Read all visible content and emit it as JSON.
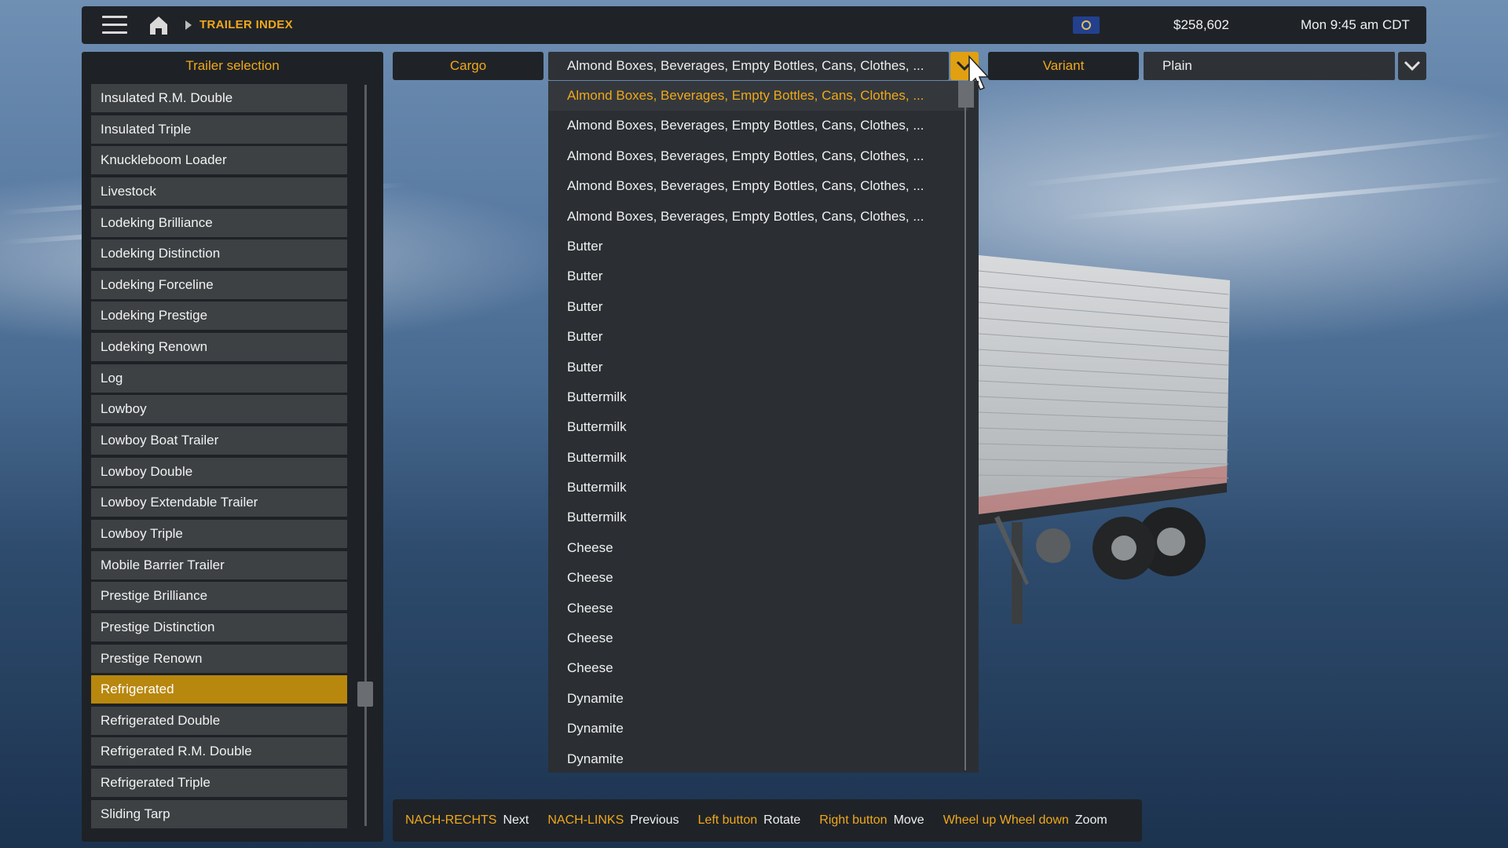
{
  "topbar": {
    "breadcrumb": "TRAILER INDEX",
    "money": "$258,602",
    "time": "Mon 9:45 am CDT"
  },
  "left_panel": {
    "title": "Trailer selection",
    "items": [
      "Insulated R.M. Double",
      "Insulated Triple",
      "Knuckleboom Loader",
      "Livestock",
      "Lodeking Brilliance",
      "Lodeking Distinction",
      "Lodeking Forceline",
      "Lodeking Prestige",
      "Lodeking Renown",
      "Log",
      "Lowboy",
      "Lowboy Boat Trailer",
      "Lowboy Double",
      "Lowboy Extendable Trailer",
      "Lowboy Triple",
      "Mobile Barrier Trailer",
      "Prestige Brilliance",
      "Prestige Distinction",
      "Prestige Renown",
      "Refrigerated",
      "Refrigerated Double",
      "Refrigerated R.M. Double",
      "Refrigerated Triple",
      "Sliding Tarp"
    ],
    "selected": "Refrigerated"
  },
  "cargo": {
    "label": "Cargo",
    "selected": "Almond Boxes, Beverages, Empty Bottles, Cans, Clothes, ...",
    "options": [
      "Almond Boxes, Beverages, Empty Bottles, Cans, Clothes, ...",
      "Almond Boxes, Beverages, Empty Bottles, Cans, Clothes, ...",
      "Almond Boxes, Beverages, Empty Bottles, Cans, Clothes, ...",
      "Almond Boxes, Beverages, Empty Bottles, Cans, Clothes, ...",
      "Almond Boxes, Beverages, Empty Bottles, Cans, Clothes, ...",
      "Butter",
      "Butter",
      "Butter",
      "Butter",
      "Butter",
      "Buttermilk",
      "Buttermilk",
      "Buttermilk",
      "Buttermilk",
      "Buttermilk",
      "Cheese",
      "Cheese",
      "Cheese",
      "Cheese",
      "Cheese",
      "Dynamite",
      "Dynamite",
      "Dynamite"
    ]
  },
  "variant": {
    "label": "Variant",
    "selected": "Plain"
  },
  "hints": [
    {
      "key": "NACH-RECHTS",
      "action": "Next"
    },
    {
      "key": "NACH-LINKS",
      "action": "Previous"
    },
    {
      "key": "Left button",
      "action": "Rotate"
    },
    {
      "key": "Right button",
      "action": "Move"
    },
    {
      "key": "Wheel up Wheel down",
      "action": "Zoom"
    }
  ],
  "colors": {
    "accent": "#f0a81a",
    "selected_bg": "#b8870e",
    "panel_bg": "#1f2328"
  }
}
